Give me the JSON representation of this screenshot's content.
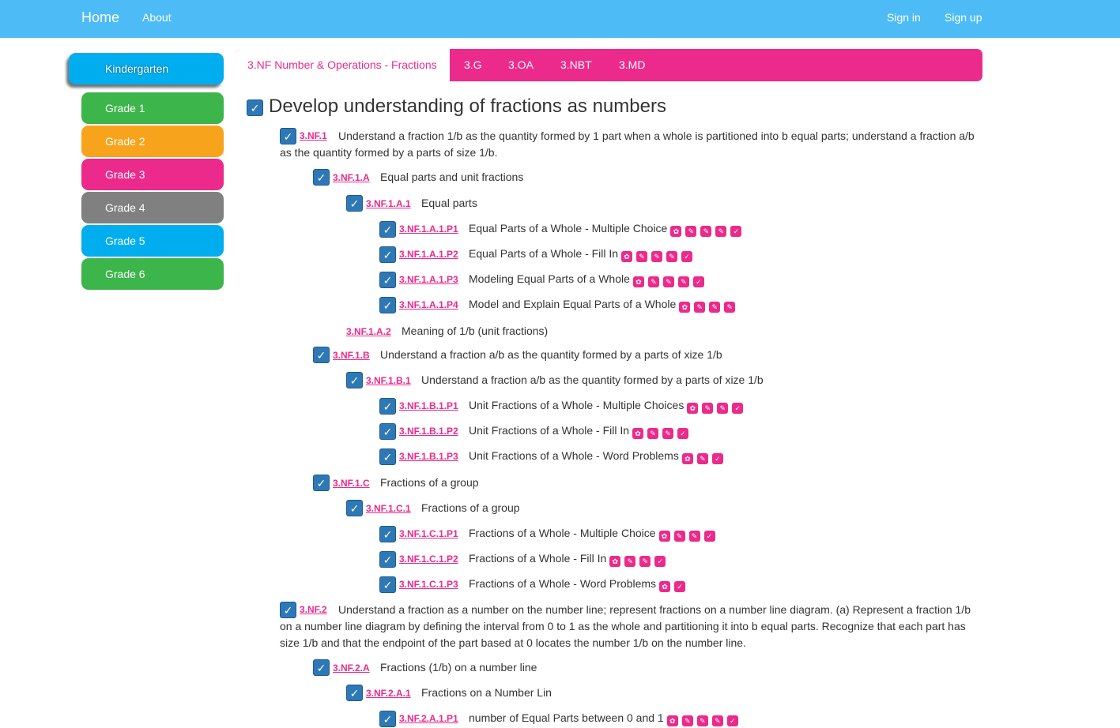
{
  "nav": {
    "home": "Home",
    "about": "About",
    "signin": "Sign in",
    "signup": "Sign up",
    "background": "#4dbcf6"
  },
  "sidebar": {
    "items": [
      {
        "label": "Kindergarten",
        "color": "#00aeef",
        "active": true
      },
      {
        "label": "Grade 1",
        "color": "#3cb54a"
      },
      {
        "label": "Grade 2",
        "color": "#f7a41c"
      },
      {
        "label": "Grade 3",
        "color": "#ec2a8c"
      },
      {
        "label": "Grade 4",
        "color": "#808080"
      },
      {
        "label": "Grade 5",
        "color": "#00aeef"
      },
      {
        "label": "Grade 6",
        "color": "#3cb54a"
      }
    ]
  },
  "tabs": [
    {
      "label": "3.NF Number & Operations - Fractions",
      "active": true
    },
    {
      "label": "3.G"
    },
    {
      "label": "3.OA"
    },
    {
      "label": "3.NBT"
    },
    {
      "label": "3.MD"
    }
  ],
  "accent_color": "#ec2a8c",
  "checkbox_color": "#2e78b6",
  "heading": "Develop understanding of fractions as numbers",
  "standards": {
    "nf1": {
      "code": "3.NF.1",
      "text": "Understand a fraction 1/b as the quantity formed by 1 part when a whole is partitioned into b equal parts; understand a fraction a/b as the quantity formed by a parts of size 1/b."
    },
    "nf1a": {
      "code": "3.NF.1.A",
      "text": "Equal parts and unit fractions"
    },
    "nf1a1": {
      "code": "3.NF.1.A.1",
      "text": "Equal parts"
    },
    "nf1a1p1": {
      "code": "3.NF.1.A.1.P1",
      "text": "Equal Parts of a Whole - Multiple Choice",
      "icons": [
        "video-icon",
        "pencil-icon",
        "pencil-icon",
        "pencil-icon",
        "check-icon"
      ]
    },
    "nf1a1p2": {
      "code": "3.NF.1.A.1.P2",
      "text": "Equal Parts of a Whole - Fill In",
      "icons": [
        "video-icon",
        "pencil-icon",
        "pencil-icon",
        "pencil-icon",
        "check-icon"
      ]
    },
    "nf1a1p3": {
      "code": "3.NF.1.A.1.P3",
      "text": "Modeling Equal Parts of a Whole",
      "icons": [
        "video-icon",
        "pencil-icon",
        "pencil-icon",
        "pencil-icon",
        "check-icon"
      ]
    },
    "nf1a1p4": {
      "code": "3.NF.1.A.1.P4",
      "text": "Model and Explain Equal Parts of a Whole",
      "icons": [
        "video-icon",
        "pencil-icon",
        "pencil-icon",
        "pencil-icon"
      ]
    },
    "nf1a2": {
      "code": "3.NF.1.A.2",
      "text": "Meaning of 1/b (unit fractions)"
    },
    "nf1b": {
      "code": "3.NF.1.B",
      "text": "Understand a fraction a/b as the quantity formed by a parts of xize 1/b"
    },
    "nf1b1": {
      "code": "3.NF.1.B.1",
      "text": "Understand a fraction a/b as the quantity formed by a parts of xize 1/b"
    },
    "nf1b1p1": {
      "code": "3.NF.1.B.1.P1",
      "text": "Unit Fractions of a Whole - Multiple Choices",
      "icons": [
        "video-icon",
        "pencil-icon",
        "pencil-icon",
        "check-icon"
      ]
    },
    "nf1b1p2": {
      "code": "3.NF.1.B.1.P2",
      "text": "Unit Fractions of a Whole - Fill In",
      "icons": [
        "video-icon",
        "pencil-icon",
        "pencil-icon",
        "check-icon"
      ]
    },
    "nf1b1p3": {
      "code": "3.NF.1.B.1.P3",
      "text": "Unit Fractions of a Whole - Word Problems",
      "icons": [
        "video-icon",
        "pencil-icon",
        "check-icon"
      ]
    },
    "nf1c": {
      "code": "3.NF.1.C",
      "text": "Fractions of a group"
    },
    "nf1c1": {
      "code": "3.NF.1.C.1",
      "text": "Fractions of a group"
    },
    "nf1c1p1": {
      "code": "3.NF.1.C.1.P1",
      "text": "Fractions of a Whole - Multiple Choice",
      "icons": [
        "video-icon",
        "pencil-icon",
        "pencil-icon",
        "check-icon"
      ]
    },
    "nf1c1p2": {
      "code": "3.NF.1.C.1.P2",
      "text": "Fractions of a Whole - Fill In",
      "icons": [
        "video-icon",
        "pencil-icon",
        "pencil-icon",
        "check-icon"
      ]
    },
    "nf1c1p3": {
      "code": "3.NF.1.C.1.P3",
      "text": "Fractions of a Whole - Word Problems",
      "icons": [
        "video-icon",
        "check-icon"
      ]
    },
    "nf2": {
      "code": "3.NF.2",
      "text": "Understand a fraction as a number on the number line; represent fractions on a number line diagram. (a) Represent a fraction 1/b on a number line diagram by defining the interval from 0 to 1 as the whole and partitioning it into b equal parts. Recognize that each part has size 1/b and that the endpoint of the part based at 0 locates the number 1/b on the number line."
    },
    "nf2a": {
      "code": "3.NF.2.A",
      "text": "Fractions (1/b) on a number line"
    },
    "nf2a1": {
      "code": "3.NF.2.A.1",
      "text": "Fractions on a Number Lin"
    },
    "nf2a1p1": {
      "code": "3.NF.2.A.1.P1",
      "text": "number of Equal Parts between 0 and 1",
      "icons": [
        "video-icon",
        "pencil-icon",
        "pencil-icon",
        "pencil-icon",
        "check-icon"
      ]
    }
  }
}
